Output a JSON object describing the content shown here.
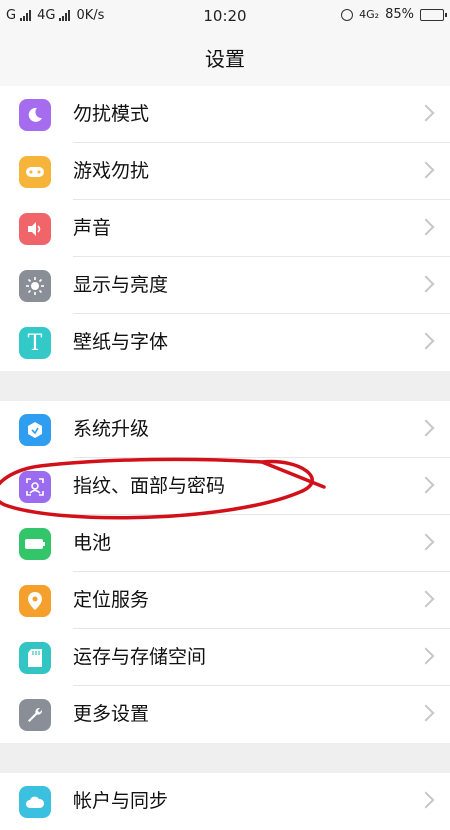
{
  "status_bar": {
    "carrier1": "G",
    "carrier2": "4G",
    "speed": "0K/s",
    "time": "10:20",
    "network": "4G₂",
    "battery": "85%",
    "battery_level": 0.85
  },
  "header": {
    "title": "设置"
  },
  "groups": [
    {
      "items": [
        {
          "label": "勿扰模式",
          "icon": "moon-icon",
          "color": "#a56cf0"
        },
        {
          "label": "游戏勿扰",
          "icon": "gamepad-icon",
          "color": "#f6b53a"
        },
        {
          "label": "声音",
          "icon": "speaker-icon",
          "color": "#f0646a"
        },
        {
          "label": "显示与亮度",
          "icon": "brightness-icon",
          "color": "#8a8f97"
        },
        {
          "label": "壁纸与字体",
          "icon": "font-t-icon",
          "color": "#33c9c8"
        }
      ]
    },
    {
      "items": [
        {
          "label": "系统升级",
          "icon": "upgrade-icon",
          "color": "#2f9ef0"
        },
        {
          "label": "指纹、面部与密码",
          "icon": "face-scan-icon",
          "color": "#9c6cf0"
        },
        {
          "label": "电池",
          "icon": "battery-icon",
          "color": "#33c56a"
        },
        {
          "label": "定位服务",
          "icon": "location-pin-icon",
          "color": "#f5a02c"
        },
        {
          "label": "运存与存储空间",
          "icon": "sd-card-icon",
          "color": "#33c5c3"
        },
        {
          "label": "更多设置",
          "icon": "wrench-icon",
          "color": "#8a8f97"
        }
      ]
    },
    {
      "items": [
        {
          "label": "帐户与同步",
          "icon": "cloud-icon",
          "color": "#3cc0e0"
        }
      ]
    }
  ]
}
